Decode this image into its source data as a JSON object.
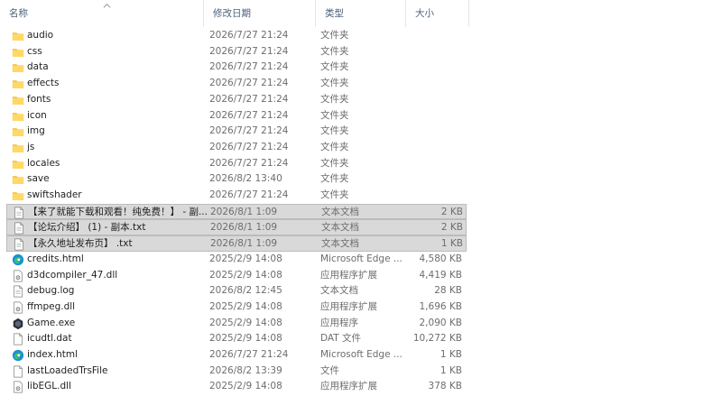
{
  "columns": {
    "name": "名称",
    "date": "修改日期",
    "type": "类型",
    "size": "大小"
  },
  "files": [
    {
      "name": "audio",
      "date": "2026/7/27 21:24",
      "type": "文件夹",
      "size": "",
      "icon": "folder-icon",
      "selected": false
    },
    {
      "name": "css",
      "date": "2026/7/27 21:24",
      "type": "文件夹",
      "size": "",
      "icon": "folder-icon",
      "selected": false
    },
    {
      "name": "data",
      "date": "2026/7/27 21:24",
      "type": "文件夹",
      "size": "",
      "icon": "folder-icon",
      "selected": false
    },
    {
      "name": "effects",
      "date": "2026/7/27 21:24",
      "type": "文件夹",
      "size": "",
      "icon": "folder-icon",
      "selected": false
    },
    {
      "name": "fonts",
      "date": "2026/7/27 21:24",
      "type": "文件夹",
      "size": "",
      "icon": "folder-icon",
      "selected": false
    },
    {
      "name": "icon",
      "date": "2026/7/27 21:24",
      "type": "文件夹",
      "size": "",
      "icon": "folder-icon",
      "selected": false
    },
    {
      "name": "img",
      "date": "2026/7/27 21:24",
      "type": "文件夹",
      "size": "",
      "icon": "folder-icon",
      "selected": false
    },
    {
      "name": "js",
      "date": "2026/7/27 21:24",
      "type": "文件夹",
      "size": "",
      "icon": "folder-icon",
      "selected": false
    },
    {
      "name": "locales",
      "date": "2026/7/27 21:24",
      "type": "文件夹",
      "size": "",
      "icon": "folder-icon",
      "selected": false
    },
    {
      "name": "save",
      "date": "2026/8/2 13:40",
      "type": "文件夹",
      "size": "",
      "icon": "folder-icon",
      "selected": false
    },
    {
      "name": "swiftshader",
      "date": "2026/7/27 21:24",
      "type": "文件夹",
      "size": "",
      "icon": "folder-icon",
      "selected": false
    },
    {
      "name": "【来了就能下载和观看！纯免费！】 - 副...",
      "date": "2026/8/1 1:09",
      "type": "文本文档",
      "size": "2 KB",
      "icon": "text-file-icon",
      "selected": true
    },
    {
      "name": "【论坛介绍】 (1) - 副本.txt",
      "date": "2026/8/1 1:09",
      "type": "文本文档",
      "size": "2 KB",
      "icon": "text-file-icon",
      "selected": true
    },
    {
      "name": "【永久地址发布页】 .txt",
      "date": "2026/8/1 1:09",
      "type": "文本文档",
      "size": "1 KB",
      "icon": "text-file-icon",
      "selected": true
    },
    {
      "name": "credits.html",
      "date": "2025/2/9 14:08",
      "type": "Microsoft Edge ...",
      "size": "4,580 KB",
      "icon": "edge-html-icon",
      "selected": false
    },
    {
      "name": "d3dcompiler_47.dll",
      "date": "2025/2/9 14:08",
      "type": "应用程序扩展",
      "size": "4,419 KB",
      "icon": "dll-file-icon",
      "selected": false
    },
    {
      "name": "debug.log",
      "date": "2026/8/2 12:45",
      "type": "文本文档",
      "size": "28 KB",
      "icon": "text-file-icon",
      "selected": false
    },
    {
      "name": "ffmpeg.dll",
      "date": "2025/2/9 14:08",
      "type": "应用程序扩展",
      "size": "1,696 KB",
      "icon": "dll-file-icon",
      "selected": false
    },
    {
      "name": "Game.exe",
      "date": "2025/2/9 14:08",
      "type": "应用程序",
      "size": "2,090 KB",
      "icon": "game-exe-icon",
      "selected": false
    },
    {
      "name": "icudtl.dat",
      "date": "2025/2/9 14:08",
      "type": "DAT 文件",
      "size": "10,272 KB",
      "icon": "blank-file-icon",
      "selected": false
    },
    {
      "name": "index.html",
      "date": "2026/7/27 21:24",
      "type": "Microsoft Edge ...",
      "size": "1 KB",
      "icon": "edge-html-icon",
      "selected": false
    },
    {
      "name": "lastLoadedTrsFile",
      "date": "2026/8/2 13:39",
      "type": "文件",
      "size": "1 KB",
      "icon": "blank-file-icon",
      "selected": false
    },
    {
      "name": "libEGL.dll",
      "date": "2025/2/9 14:08",
      "type": "应用程序扩展",
      "size": "378 KB",
      "icon": "dll-file-icon",
      "selected": false
    }
  ]
}
